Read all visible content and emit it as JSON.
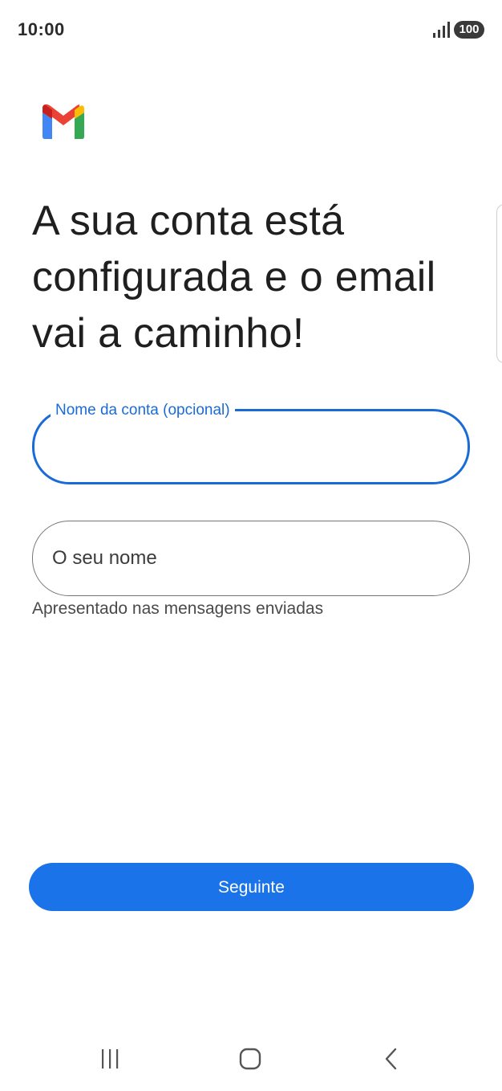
{
  "status_bar": {
    "time": "10:00",
    "signal_icon": "signal-bars-icon",
    "battery_level": "100"
  },
  "app": {
    "logo_icon": "gmail-logo-icon",
    "logo_colors": [
      "#4285F4",
      "#EA4335",
      "#FBBC04",
      "#34A853",
      "#C5221F"
    ]
  },
  "headline": "A sua conta está configurada e o email vai a caminho!",
  "form": {
    "account_name": {
      "label": "Nome da conta (opcional)",
      "value": ""
    },
    "your_name": {
      "placeholder": "O seu nome",
      "value": "",
      "helper": "Apresentado nas mensagens enviadas"
    }
  },
  "actions": {
    "next_label": "Seguinte"
  },
  "nav_bar": {
    "recents_icon": "recents-icon",
    "home_icon": "home-icon",
    "back_icon": "back-icon"
  },
  "colors": {
    "accent": "#1A73E8",
    "focus_outline": "#1A6BD6",
    "text_primary": "#1F1F1F",
    "outline": "#767676"
  }
}
